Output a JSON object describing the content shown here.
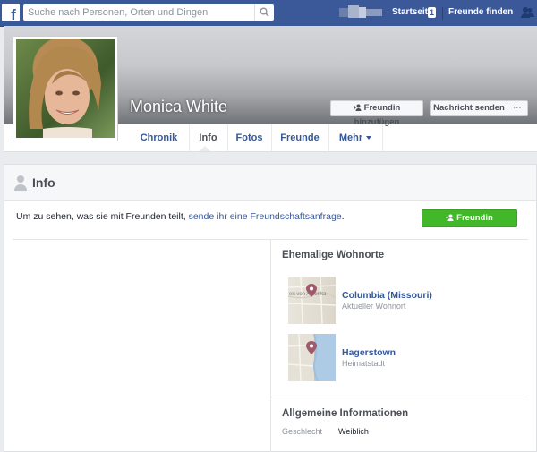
{
  "topbar": {
    "logo_letter": "f",
    "search_placeholder": "Suche nach Personen, Orten und Dingen",
    "nav_home_label": "Startseite",
    "nav_home_badge": "1",
    "nav_find_friends_label": "Freunde finden"
  },
  "profile": {
    "name": "Monica White",
    "add_friend_label": "Freundin hinzufügen",
    "message_label": "Nachricht senden",
    "more_label": "···"
  },
  "tabs": [
    {
      "label": "Chronik"
    },
    {
      "label": "Info"
    },
    {
      "label": "Fotos"
    },
    {
      "label": "Freunde"
    },
    {
      "label": "Mehr"
    }
  ],
  "info": {
    "title": "Info",
    "note_text": "Um zu sehen, was sie mit Freunden teilt, ",
    "note_link": "sende ihr eine Freundschaftsanfrage",
    "note_end": ".",
    "add_friend_label": "Freundin hinzufügen"
  },
  "places": {
    "title": "Ehemalige Wohnorte",
    "items": [
      {
        "name": "Columbia (Missouri)",
        "sub": "Aktueller Wohnort",
        "map_text": "en von Amerika"
      },
      {
        "name": "Hagerstown",
        "sub": "Heimatstadt",
        "map_text": ""
      }
    ]
  },
  "general": {
    "title": "Allgemeine Informationen",
    "rows": [
      {
        "label": "Geschlecht",
        "value": "Weiblich"
      }
    ]
  },
  "colors": {
    "brand": "#3b5998",
    "link": "#365899",
    "green": "#42b72a",
    "map_pin": "#a05a6b"
  }
}
